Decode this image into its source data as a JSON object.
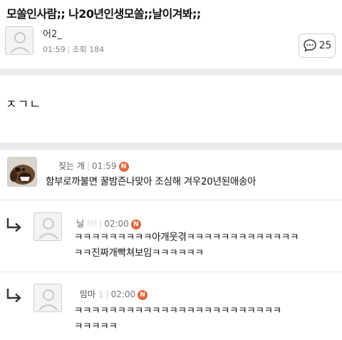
{
  "post": {
    "title": "모쏠인사람;; 나20년인생모쏠;;날이겨봐;;",
    "author_name": "어2_",
    "time": "01:59",
    "views_label": "조회",
    "views": "184",
    "comment_count": "25",
    "body": "ㅈㄱㄴ"
  },
  "comments": [
    {
      "author": "짖는 개",
      "time": "01:59",
      "badge": "N",
      "text": "함부로까불면 꿀밤즌나맞아 조심해 겨우20년된애송아"
    },
    {
      "author": "닐",
      "author_hidden": "!!!",
      "time": "02:00",
      "badge": "N",
      "text_line1": "ㅋㅋㅋㅋㅋㅋㅋㅋㅋ아개웃겪ㅋㅋㅋㅋㅋㅋㅋㅋㅋㅋㅋㅋㅋ",
      "text_line2": "ㅋㅋ진짜개빡쳐보임ㅋㅋㅋㅋㅋㅋ"
    },
    {
      "author": "맘마",
      "author_hidden": "1",
      "time": "02:00",
      "badge": "N",
      "text_line1": "ㅋㅋㅋㅋㅋㅋㅋㅋㅋㅋㅋㅋㅋㅋㅋㅋㅋㅋㅋㅋㅋㅋㅋㅋ",
      "text_line2": "ㅋㅋㅋㅋㅋ"
    }
  ],
  "icons": {
    "avatar": "default-avatar-icon",
    "comment": "speech-bubble-icon",
    "reply": "reply-arrow-icon"
  },
  "colors": {
    "badge": "#e0683c",
    "divider": "#ececec"
  }
}
